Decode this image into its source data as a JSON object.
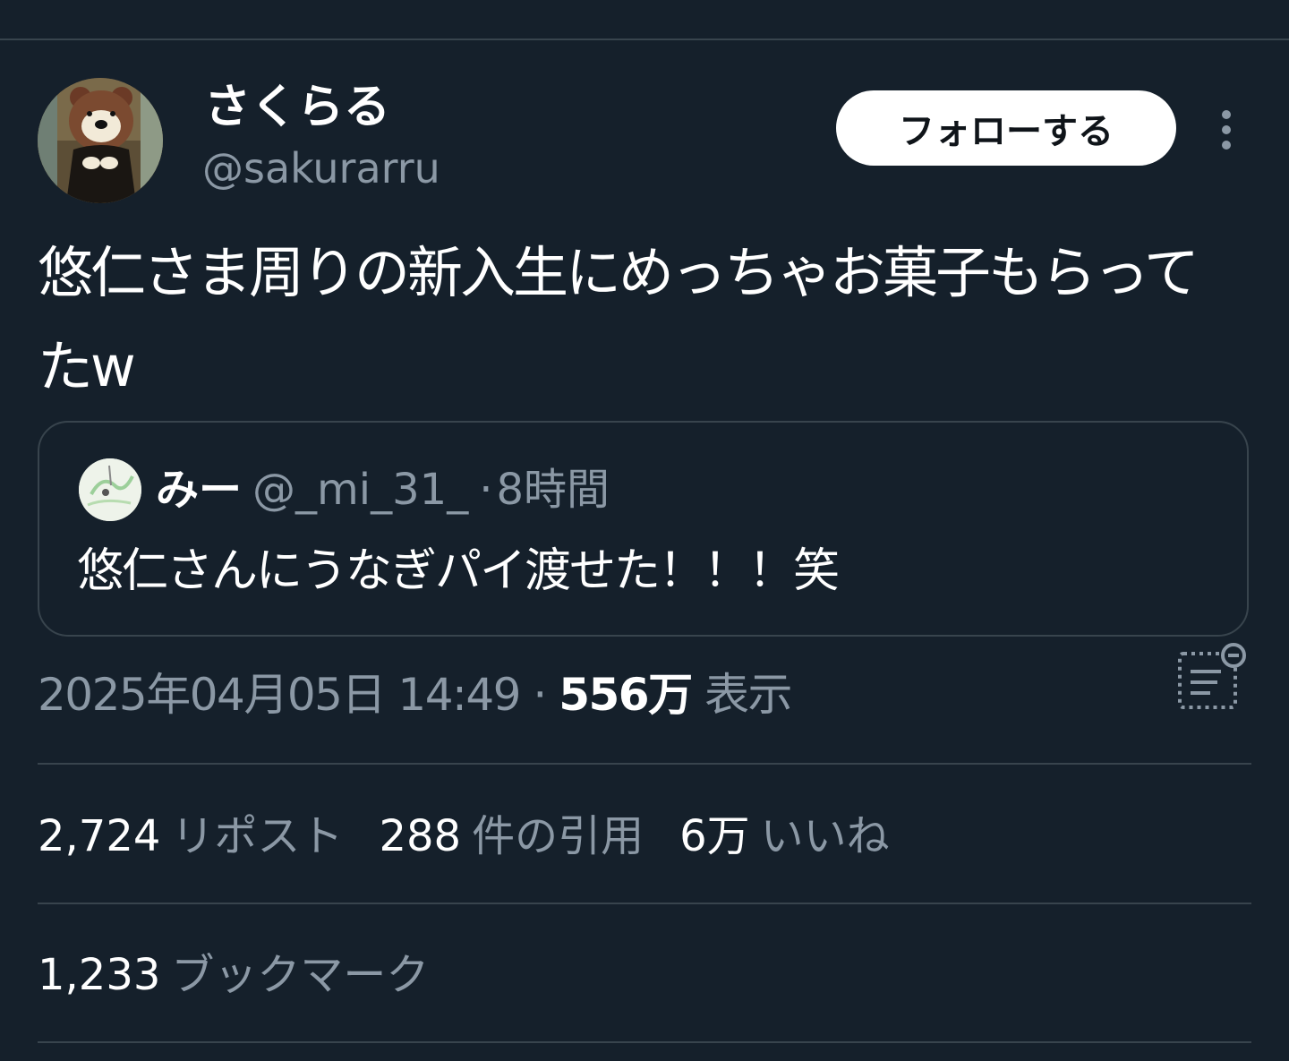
{
  "author": {
    "display_name": "さくらる",
    "handle": "@sakurarru",
    "avatar_icon": "bear-mascot-avatar"
  },
  "actions": {
    "follow_label": "フォローする",
    "more_icon": "more-vertical-icon"
  },
  "tweet": {
    "text": "悠仁さま周りの新入生にめっちゃお菓子もらってたw"
  },
  "quote": {
    "display_name": "みー",
    "handle": "@_mi_31_",
    "separator": "·",
    "time_ago": "8時間",
    "text": "悠仁さんにうなぎパイ渡せた！！！笑"
  },
  "meta": {
    "timestamp": "2025年04月05日 14:49",
    "separator": "·",
    "views_count": "556万",
    "views_label": "表示",
    "analytics_icon": "analytics-icon"
  },
  "stats": {
    "reposts_count": "2,724",
    "reposts_label": "リポスト",
    "quotes_count": "288",
    "quotes_label": "件の引用",
    "likes_count": "6万",
    "likes_label": "いいね",
    "bookmarks_count": "1,233",
    "bookmarks_label": "ブックマーク"
  },
  "colors": {
    "background": "#15202b",
    "secondary_text": "#8b98a5",
    "divider": "#38444d"
  }
}
